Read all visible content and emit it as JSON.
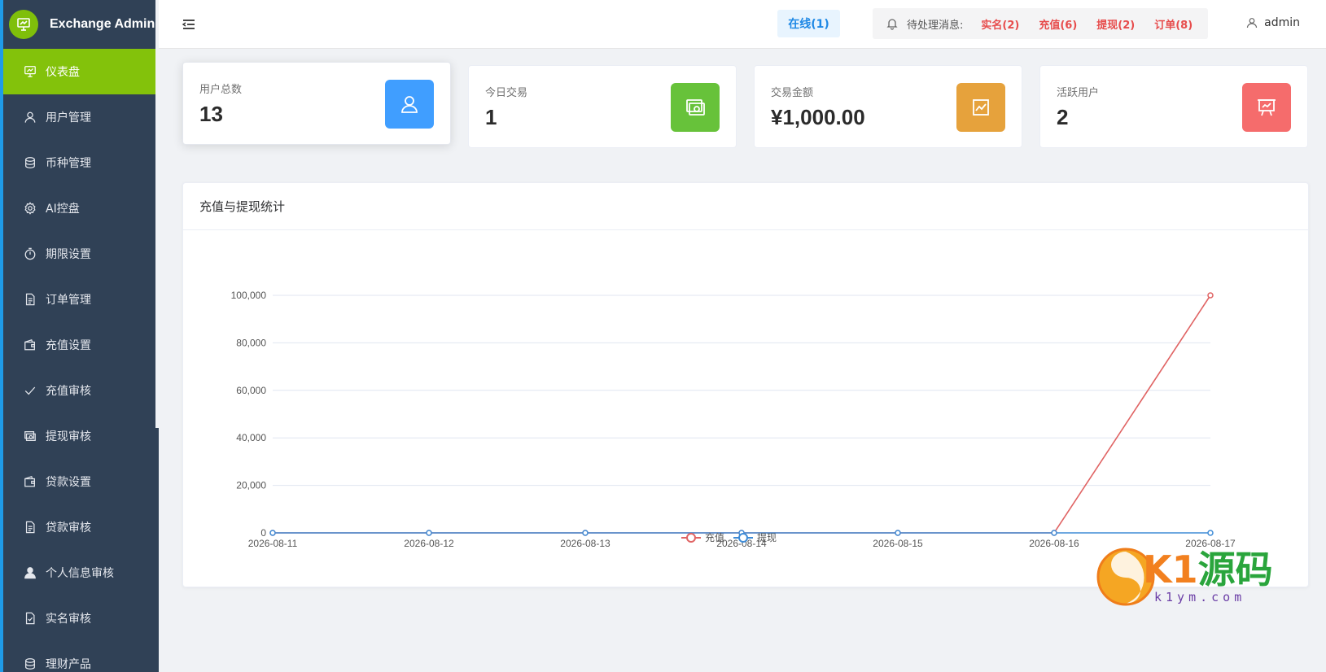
{
  "app": {
    "title": "Exchange Admin"
  },
  "sidebar": {
    "items": [
      {
        "label": "仪表盘",
        "icon": "dashboard-icon",
        "active": true
      },
      {
        "label": "用户管理",
        "icon": "user-icon"
      },
      {
        "label": "币种管理",
        "icon": "coins-icon"
      },
      {
        "label": "AI控盘",
        "icon": "gear-icon"
      },
      {
        "label": "期限设置",
        "icon": "timer-icon"
      },
      {
        "label": "订单管理",
        "icon": "document-icon"
      },
      {
        "label": "充值设置",
        "icon": "wallet-icon"
      },
      {
        "label": "充值审核",
        "icon": "check-icon"
      },
      {
        "label": "提现审核",
        "icon": "money-icon"
      },
      {
        "label": "贷款设置",
        "icon": "wallet-icon"
      },
      {
        "label": "贷款审核",
        "icon": "document-icon"
      },
      {
        "label": "个人信息审核",
        "icon": "person-filled-icon"
      },
      {
        "label": "实名审核",
        "icon": "verify-doc-icon"
      },
      {
        "label": "理财产品",
        "icon": "coins-icon"
      }
    ]
  },
  "header": {
    "online": "在线(1)",
    "notify_label": "待处理消息:",
    "tags": [
      "实名(2)",
      "充值(6)",
      "提现(2)",
      "订单(8)"
    ],
    "user": "admin"
  },
  "stats": [
    {
      "label": "用户总数",
      "value": "13",
      "color": "#409eff",
      "icon": "user-icon"
    },
    {
      "label": "今日交易",
      "value": "1",
      "color": "#67c23a",
      "icon": "money-icon"
    },
    {
      "label": "交易金额",
      "value": "¥1,000.00",
      "color": "#e6a23c",
      "icon": "trend-icon"
    },
    {
      "label": "活跃用户",
      "value": "2",
      "color": "#f56c6c",
      "icon": "presentation-icon"
    }
  ],
  "panel": {
    "title": "充值与提现统计"
  },
  "chart_data": {
    "type": "line",
    "x": [
      "2026-08-11",
      "2026-08-12",
      "2026-08-13",
      "2026-08-14",
      "2026-08-15",
      "2026-08-16",
      "2026-08-17"
    ],
    "ylim": [
      0,
      100000
    ],
    "yticks": [
      "0",
      "20,000",
      "40,000",
      "60,000",
      "80,000",
      "100,000"
    ],
    "grid": true,
    "legend": "bottom-center",
    "series": [
      {
        "name": "充值",
        "color": "#e06464",
        "values": [
          0,
          0,
          0,
          0,
          0,
          0,
          100000
        ]
      },
      {
        "name": "提现",
        "color": "#3e8bd6",
        "values": [
          0,
          0,
          0,
          0,
          0,
          0,
          0
        ]
      }
    ]
  },
  "watermark": {
    "main_k": "K1",
    "main_g": "源码",
    "sub": "k1ym.com"
  }
}
